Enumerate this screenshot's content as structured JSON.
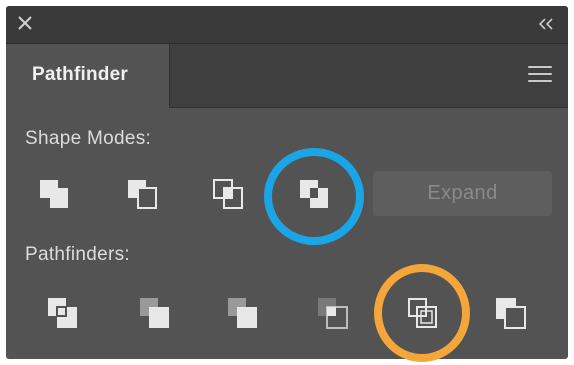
{
  "panel": {
    "tab_label": "Pathfinder",
    "shape_modes_label": "Shape Modes:",
    "pathfinders_label": "Pathfinders:",
    "expand_label": "Expand"
  },
  "icons": {
    "close": "close-icon",
    "collapse": "double-chevron-left-icon",
    "menu": "hamburger-menu-icon",
    "shape_modes": [
      "unite-icon",
      "minus-front-icon",
      "intersect-icon",
      "exclude-icon"
    ],
    "pathfinders": [
      "divide-icon",
      "trim-icon",
      "merge-icon",
      "crop-icon",
      "outline-icon",
      "minus-back-icon"
    ]
  },
  "colors": {
    "panel_bg": "#535353",
    "title_bg": "#3a3a3a",
    "highlight_blue": "#1aa6e6",
    "highlight_orange": "#f5a63a"
  }
}
